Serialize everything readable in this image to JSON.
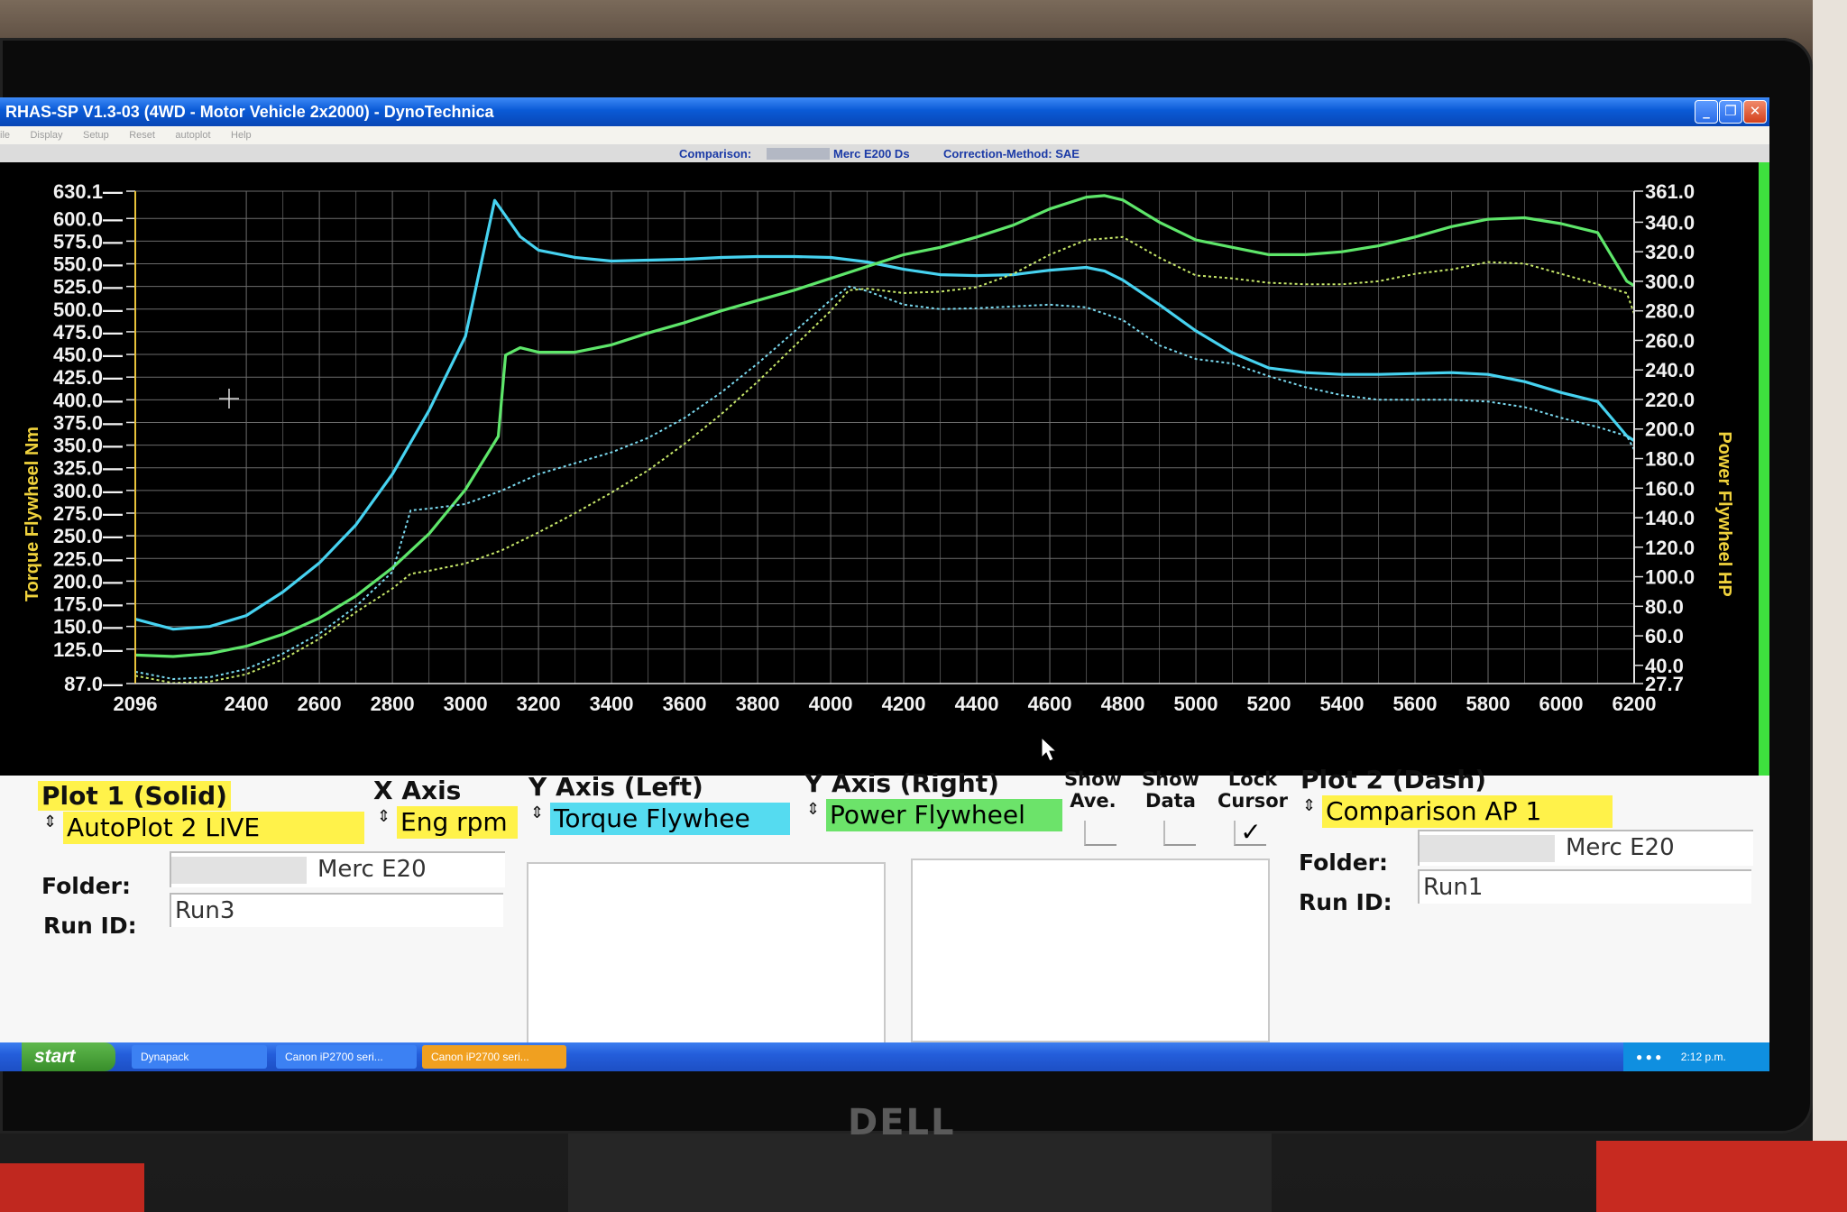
{
  "window": {
    "title": "RHAS-SP V1.3-03  (4WD - Motor Vehicle 2x2000) - DynoTechnica",
    "minimize_glyph": "_",
    "maximize_glyph": "❐",
    "close_glyph": "✕"
  },
  "menu": [
    "ile",
    "Display",
    "Setup",
    "Reset",
    "autoplot",
    "Help"
  ],
  "infobar": {
    "comparison_label": "Comparison:",
    "vehicle": "Merc E200 Ds",
    "correction": "Correction-Method: SAE"
  },
  "chart_data": {
    "type": "line",
    "xlabel": "",
    "ylabel_left": "Torque Flywheel Nm",
    "ylabel_right": "Power Flywheel HP",
    "xlim": [
      2096,
      6200
    ],
    "ylim_left": [
      87.0,
      630.1
    ],
    "ylim_right": [
      27.7,
      361.0
    ],
    "x_ticks": [
      "2096",
      "2400",
      "2600",
      "2800",
      "3000",
      "3200",
      "3400",
      "3600",
      "3800",
      "4000",
      "4200",
      "4400",
      "4600",
      "4800",
      "5000",
      "5200",
      "5400",
      "5600",
      "5800",
      "6000",
      "6200"
    ],
    "y_left_ticks": [
      "630.1",
      "600.0",
      "575.0",
      "550.0",
      "525.0",
      "500.0",
      "475.0",
      "450.0",
      "425.0",
      "400.0",
      "375.0",
      "350.0",
      "325.0",
      "300.0",
      "275.0",
      "250.0",
      "225.0",
      "200.0",
      "175.0",
      "150.0",
      "125.0",
      "87.0"
    ],
    "y_right_ticks": [
      "361.0",
      "340.0",
      "320.0",
      "300.0",
      "280.0",
      "260.0",
      "240.0",
      "220.0",
      "200.0",
      "180.0",
      "160.0",
      "140.0",
      "120.0",
      "100.0",
      "80.0",
      "60.0",
      "40.0",
      "27.7"
    ],
    "grid": true,
    "series": [
      {
        "name": "AutoPlot 2 LIVE",
        "quantity": "Torque Flywheel",
        "axis": "left",
        "style": "solid",
        "color": "#46d2f0",
        "x": [
          2096,
          2200,
          2300,
          2400,
          2500,
          2600,
          2700,
          2800,
          2900,
          3000,
          3080,
          3150,
          3200,
          3300,
          3400,
          3500,
          3600,
          3700,
          3800,
          3900,
          4000,
          4100,
          4200,
          4300,
          4400,
          4500,
          4600,
          4700,
          4750,
          4800,
          4900,
          5000,
          5100,
          5200,
          5300,
          5400,
          5500,
          5600,
          5700,
          5800,
          5900,
          6000,
          6100,
          6180,
          6200
        ],
        "y": [
          158,
          147,
          150,
          162,
          188,
          220,
          262,
          318,
          388,
          470,
          620,
          580,
          565,
          557,
          553,
          554,
          555,
          557,
          558,
          558,
          557,
          552,
          544,
          538,
          537,
          538,
          543,
          546,
          542,
          532,
          505,
          476,
          452,
          435,
          430,
          428,
          428,
          429,
          430,
          428,
          420,
          408,
          398,
          360,
          355
        ]
      },
      {
        "name": "AutoPlot 2 LIVE",
        "quantity": "Power Flywheel",
        "axis": "right",
        "style": "solid",
        "color": "#5ee66a",
        "x": [
          2096,
          2200,
          2300,
          2400,
          2500,
          2600,
          2700,
          2800,
          2900,
          3000,
          3090,
          3110,
          3150,
          3200,
          3300,
          3400,
          3500,
          3600,
          3700,
          3800,
          3900,
          4000,
          4100,
          4200,
          4300,
          4400,
          4500,
          4600,
          4700,
          4750,
          4800,
          4900,
          5000,
          5100,
          5200,
          5300,
          5400,
          5500,
          5600,
          5700,
          5800,
          5900,
          6000,
          6100,
          6180,
          6200
        ],
        "y": [
          47,
          46,
          48,
          53,
          61,
          72,
          87,
          106,
          129,
          159,
          195,
          250,
          255,
          252,
          252,
          257,
          265,
          272,
          280,
          287,
          294,
          302,
          310,
          318,
          323,
          330,
          338,
          349,
          357,
          358,
          355,
          340,
          328,
          323,
          318,
          318,
          320,
          324,
          330,
          337,
          342,
          343,
          339,
          333,
          300,
          297
        ]
      },
      {
        "name": "Comparison AP 1",
        "quantity": "Torque Flywheel",
        "axis": "left",
        "style": "dash",
        "color": "#7ad9ef",
        "x": [
          2096,
          2200,
          2300,
          2400,
          2500,
          2600,
          2700,
          2800,
          2850,
          2900,
          3000,
          3100,
          3200,
          3300,
          3400,
          3500,
          3600,
          3700,
          3800,
          3900,
          4000,
          4050,
          4100,
          4200,
          4300,
          4400,
          4500,
          4600,
          4700,
          4800,
          4900,
          5000,
          5100,
          5200,
          5300,
          5400,
          5500,
          5600,
          5700,
          5800,
          5900,
          6000,
          6100,
          6180,
          6200
        ],
        "y": [
          100,
          92,
          94,
          103,
          120,
          142,
          172,
          210,
          278,
          280,
          285,
          300,
          318,
          330,
          342,
          358,
          380,
          408,
          440,
          475,
          510,
          525,
          520,
          505,
          500,
          501,
          503,
          505,
          502,
          488,
          460,
          445,
          440,
          426,
          414,
          405,
          400,
          400,
          400,
          398,
          392,
          380,
          370,
          360,
          345
        ]
      },
      {
        "name": "Comparison AP 1",
        "quantity": "Power Flywheel",
        "axis": "right",
        "style": "dash",
        "color": "#c8e86a",
        "x": [
          2096,
          2200,
          2300,
          2400,
          2500,
          2600,
          2700,
          2800,
          2850,
          2900,
          3000,
          3100,
          3200,
          3300,
          3400,
          3500,
          3600,
          3700,
          3800,
          3900,
          4000,
          4050,
          4100,
          4200,
          4300,
          4400,
          4500,
          4600,
          4700,
          4800,
          4900,
          5000,
          5100,
          5200,
          5300,
          5400,
          5500,
          5600,
          5700,
          5800,
          5900,
          6000,
          6100,
          6180,
          6200
        ],
        "y": [
          33,
          28,
          29,
          34,
          44,
          58,
          76,
          92,
          102,
          104,
          109,
          118,
          130,
          143,
          157,
          172,
          190,
          210,
          232,
          256,
          280,
          294,
          295,
          292,
          293,
          296,
          305,
          318,
          328,
          330,
          316,
          304,
          302,
          299,
          298,
          298,
          300,
          305,
          308,
          313,
          312,
          305,
          298,
          292,
          278
        ]
      }
    ]
  },
  "controls": {
    "plot1": {
      "label": "Plot 1 (Solid)",
      "value": "AutoPlot 2 LIVE",
      "folder_label": "Folder:",
      "folder_value": "Merc E20",
      "runid_label": "Run ID:",
      "runid_value": "Run3"
    },
    "xaxis": {
      "label": "X Axis",
      "value": "Eng rpm"
    },
    "yleft": {
      "label": "Y Axis (Left)",
      "value": "Torque Flywhee"
    },
    "yright": {
      "label": "Y Axis (Right)",
      "value": "Power Flywheel"
    },
    "show_ave": {
      "label_line1": "Show",
      "label_line2": "Ave.",
      "checked": false
    },
    "show_data": {
      "label_line1": "Show",
      "label_line2": "Data",
      "checked": false
    },
    "lock_cursor": {
      "label_line1": "Lock",
      "label_line2": "Cursor",
      "checked": true,
      "mark": "✓"
    },
    "plot2": {
      "label": "Plot 2 (Dash)",
      "value": "Comparison AP 1",
      "folder_label": "Folder:",
      "folder_value": "Merc E20",
      "runid_label": "Run ID:",
      "runid_value": "Run1"
    },
    "spinner_glyph": "⇕"
  },
  "taskbar": {
    "start": "start",
    "tasks": [
      "Dynapack",
      "Canon iP2700 seri...",
      "Canon iP2700 seri..."
    ],
    "clock": "2:12 p.m."
  },
  "monitor_brand": "DELL"
}
